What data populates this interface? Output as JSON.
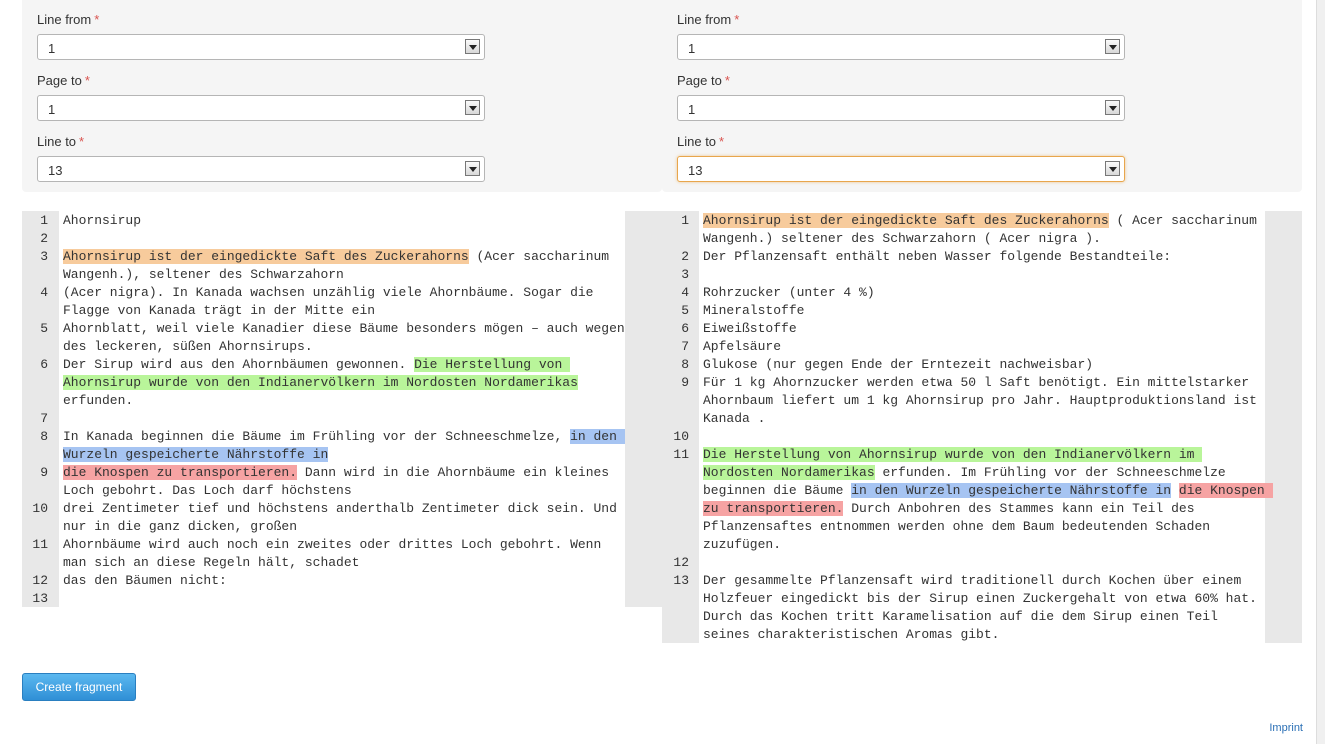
{
  "left_form": {
    "line_from": {
      "label": "Line from",
      "value": "1"
    },
    "page_to": {
      "label": "Page to",
      "value": "1"
    },
    "line_to": {
      "label": "Line to",
      "value": "13"
    }
  },
  "right_form": {
    "line_from": {
      "label": "Line from",
      "value": "1"
    },
    "page_to": {
      "label": "Page to",
      "value": "1"
    },
    "line_to": {
      "label": "Line to",
      "value": "13"
    }
  },
  "required_mark": "*",
  "left_lines": [
    {
      "n": "1",
      "segs": [
        {
          "t": "Ahornsirup"
        }
      ]
    },
    {
      "n": "2",
      "segs": []
    },
    {
      "n": "3",
      "segs": [
        {
          "t": "Ahornsirup ist der eingedickte Saft des Zuckerahorns",
          "h": "orange"
        },
        {
          "t": " (Acer saccharinum Wangenh.), seltener des Schwarzahorn"
        }
      ]
    },
    {
      "n": "4",
      "segs": [
        {
          "t": "(Acer nigra). In Kanada wachsen unzählig viele Ahornbäume. Sogar die Flagge von Kanada trägt in der Mitte ein"
        }
      ]
    },
    {
      "n": "5",
      "segs": [
        {
          "t": "Ahornblatt, weil viele Kanadier diese Bäume besonders mögen – auch wegen des leckeren, süßen Ahornsirups."
        }
      ]
    },
    {
      "n": "6",
      "segs": [
        {
          "t": "Der Sirup wird aus den Ahornbäumen gewonnen. "
        },
        {
          "t": "Die Herstellung von Ahornsirup wurde von den Indianervölkern im Nordosten Nordamerikas",
          "h": "green"
        },
        {
          "t": " erfunden."
        }
      ]
    },
    {
      "n": "7",
      "segs": []
    },
    {
      "n": "8",
      "segs": [
        {
          "t": "In Kanada beginnen die Bäume im Frühling vor der Schneeschmelze, "
        },
        {
          "t": "in den Wurzeln gespeicherte Nährstoffe in",
          "h": "blue"
        }
      ]
    },
    {
      "n": "9",
      "segs": [
        {
          "t": "die Knospen zu transportieren.",
          "h": "red"
        },
        {
          "t": " Dann wird in die Ahornbäume ein kleines Loch gebohrt. Das Loch darf höchstens"
        }
      ]
    },
    {
      "n": "10",
      "segs": [
        {
          "t": "drei Zentimeter tief und höchstens anderthalb Zentimeter dick sein. Und nur in die ganz dicken, großen"
        }
      ]
    },
    {
      "n": "11",
      "segs": [
        {
          "t": "Ahornbäume wird auch noch ein zweites oder drittes Loch gebohrt. Wenn man sich an diese Regeln hält, schadet"
        }
      ]
    },
    {
      "n": "12",
      "segs": [
        {
          "t": "das den Bäumen nicht:"
        }
      ]
    },
    {
      "n": "13",
      "segs": []
    }
  ],
  "right_lines": [
    {
      "n": "1",
      "segs": [
        {
          "t": "Ahornsirup ist der eingedickte Saft des Zuckerahorns",
          "h": "orange"
        },
        {
          "t": " ( Acer saccharinum Wangenh.) seltener des Schwarzahorn ( Acer nigra )."
        }
      ]
    },
    {
      "n": "2",
      "segs": [
        {
          "t": "Der Pflanzensaft enthält neben Wasser folgende Bestandteile:"
        }
      ]
    },
    {
      "n": "3",
      "segs": []
    },
    {
      "n": "4",
      "segs": [
        {
          "t": "Rohrzucker (unter 4 %)"
        }
      ]
    },
    {
      "n": "5",
      "segs": [
        {
          "t": "Mineralstoffe"
        }
      ]
    },
    {
      "n": "6",
      "segs": [
        {
          "t": "Eiweißstoffe"
        }
      ]
    },
    {
      "n": "7",
      "segs": [
        {
          "t": "Apfelsäure"
        }
      ]
    },
    {
      "n": "8",
      "segs": [
        {
          "t": "Glukose (nur gegen Ende der Erntezeit nachweisbar)"
        }
      ]
    },
    {
      "n": "9",
      "segs": [
        {
          "t": "Für 1 kg Ahornzucker werden etwa 50 l Saft benötigt. Ein mittelstarker Ahornbaum liefert um 1 kg Ahornsirup pro Jahr. Hauptproduktionsland ist Kanada ."
        }
      ]
    },
    {
      "n": "10",
      "segs": []
    },
    {
      "n": "11",
      "segs": [
        {
          "t": "Die Herstellung von Ahornsirup wurde von den Indianervölkern im Nordosten Nordamerikas",
          "h": "green"
        },
        {
          "t": " erfunden. Im Frühling vor der Schneeschmelze beginnen die Bäume "
        },
        {
          "t": "in den Wurzeln gespeicherte Nährstoffe in",
          "h": "blue"
        },
        {
          "t": " "
        },
        {
          "t": "die Knospen zu transportieren.",
          "h": "red"
        },
        {
          "t": " Durch Anbohren des Stammes kann ein Teil des Pflanzensaftes entnommen werden ohne dem Baum bedeutenden Schaden zuzufügen."
        }
      ]
    },
    {
      "n": "12",
      "segs": []
    },
    {
      "n": "13",
      "segs": [
        {
          "t": "Der gesammelte Pflanzensaft wird traditionell durch Kochen über einem Holzfeuer eingedickt bis der Sirup einen Zuckergehalt von etwa 60% hat. Durch das Kochen tritt Karamelisation auf die dem Sirup einen Teil seines charakteristischen Aromas gibt."
        }
      ]
    }
  ],
  "create_button": "Create fragment",
  "imprint_link": "Imprint"
}
